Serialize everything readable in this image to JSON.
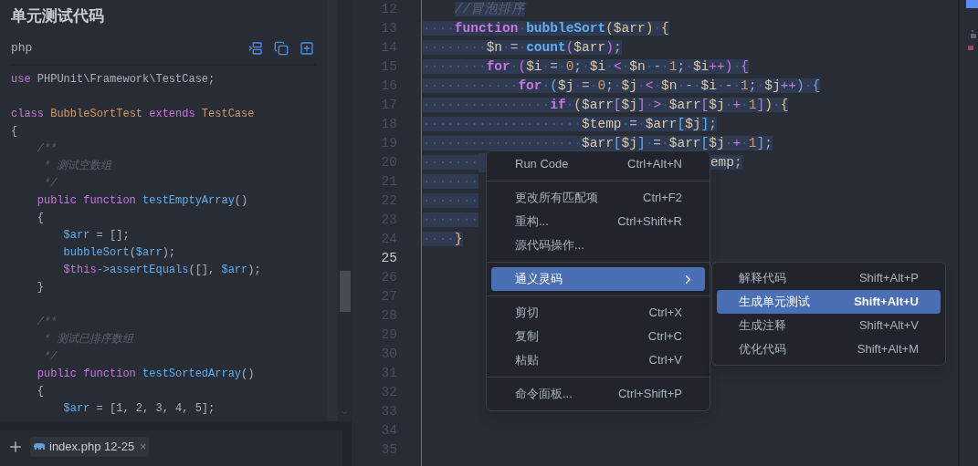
{
  "left_panel": {
    "title": "单元测试代码",
    "language": "php",
    "code_lines": [
      {
        "kind": "code",
        "tokens": [
          {
            "kind": "kw",
            "text": "use"
          },
          {
            "kind": "tx",
            "text": " PHPUnit\\Framework\\TestCase;"
          }
        ]
      },
      {
        "kind": "blank"
      },
      {
        "kind": "code",
        "tokens": [
          {
            "kind": "kw",
            "text": "class "
          },
          {
            "kind": "cls",
            "text": "BubbleSortTest "
          },
          {
            "kind": "kw",
            "text": "extends "
          },
          {
            "kind": "cls",
            "text": "TestCase"
          }
        ]
      },
      {
        "kind": "code",
        "tokens": [
          {
            "kind": "tx",
            "text": "{"
          }
        ]
      },
      {
        "kind": "code",
        "tokens": [
          {
            "kind": "cm",
            "text": "    /**"
          }
        ]
      },
      {
        "kind": "code",
        "tokens": [
          {
            "kind": "cm",
            "text": "     * 测试空数组"
          }
        ]
      },
      {
        "kind": "code",
        "tokens": [
          {
            "kind": "cm",
            "text": "     */"
          }
        ]
      },
      {
        "kind": "code",
        "tokens": [
          {
            "kind": "kw",
            "text": "    public function "
          },
          {
            "kind": "fn",
            "text": "testEmptyArray"
          },
          {
            "kind": "tx",
            "text": "()"
          }
        ]
      },
      {
        "kind": "code",
        "tokens": [
          {
            "kind": "tx",
            "text": "    {"
          }
        ]
      },
      {
        "kind": "code",
        "tokens": [
          {
            "kind": "var",
            "text": "        $arr"
          },
          {
            "kind": "tx",
            "text": " = [];"
          }
        ]
      },
      {
        "kind": "code",
        "tokens": [
          {
            "kind": "fn",
            "text": "        bubbleSort"
          },
          {
            "kind": "tx",
            "text": "("
          },
          {
            "kind": "var",
            "text": "$arr"
          },
          {
            "kind": "tx",
            "text": ");"
          }
        ]
      },
      {
        "kind": "code",
        "tokens": [
          {
            "kind": "th",
            "text": "        $this"
          },
          {
            "kind": "fn",
            "text": "->assertEquals"
          },
          {
            "kind": "tx",
            "text": "([], "
          },
          {
            "kind": "var",
            "text": "$arr"
          },
          {
            "kind": "tx",
            "text": ");"
          }
        ]
      },
      {
        "kind": "code",
        "tokens": [
          {
            "kind": "tx",
            "text": "    }"
          }
        ]
      },
      {
        "kind": "blank"
      },
      {
        "kind": "code",
        "tokens": [
          {
            "kind": "cm",
            "text": "    /**"
          }
        ]
      },
      {
        "kind": "code",
        "tokens": [
          {
            "kind": "cm",
            "text": "     * 测试已排序数组"
          }
        ]
      },
      {
        "kind": "code",
        "tokens": [
          {
            "kind": "cm",
            "text": "     */"
          }
        ]
      },
      {
        "kind": "code",
        "tokens": [
          {
            "kind": "kw",
            "text": "    public function "
          },
          {
            "kind": "fn",
            "text": "testSortedArray"
          },
          {
            "kind": "tx",
            "text": "()"
          }
        ]
      },
      {
        "kind": "code",
        "tokens": [
          {
            "kind": "tx",
            "text": "    {"
          }
        ]
      },
      {
        "kind": "code",
        "tokens": [
          {
            "kind": "var",
            "text": "        $arr"
          },
          {
            "kind": "tx",
            "text": " = [1, 2, 3, 4, 5];"
          }
        ]
      }
    ]
  },
  "bottom_bar": {
    "tab": {
      "label": "index.php 12-25",
      "close": "×"
    }
  },
  "editor": {
    "lines": [
      {
        "number": "12",
        "current": false,
        "selected": true,
        "kind": "indented",
        "tokens": [
          {
            "kind": "cm",
            "text": "//冒泡排序"
          }
        ]
      },
      {
        "number": "13",
        "current": false,
        "selected": true,
        "kind": "code",
        "tokens": [
          {
            "kind": "ws",
            "text": "····"
          },
          {
            "kind": "kw",
            "text": "function"
          },
          {
            "kind": "ws",
            "text": "·"
          },
          {
            "kind": "fn",
            "text": "bubbleSort"
          },
          {
            "kind": "b1",
            "text": "("
          },
          {
            "kind": "var",
            "text": "$arr"
          },
          {
            "kind": "b1",
            "text": ")"
          },
          {
            "kind": "ws",
            "text": "·"
          },
          {
            "kind": "b1",
            "text": "{"
          }
        ]
      },
      {
        "number": "14",
        "current": false,
        "selected": true,
        "kind": "code",
        "tokens": [
          {
            "kind": "ws",
            "text": "········"
          },
          {
            "kind": "var",
            "text": "$n"
          },
          {
            "kind": "ws",
            "text": "·"
          },
          {
            "kind": "p",
            "text": "="
          },
          {
            "kind": "ws",
            "text": "·"
          },
          {
            "kind": "fn",
            "text": "count"
          },
          {
            "kind": "b2",
            "text": "("
          },
          {
            "kind": "var",
            "text": "$arr"
          },
          {
            "kind": "b2",
            "text": ")"
          },
          {
            "kind": "p",
            "text": ";"
          }
        ]
      },
      {
        "number": "15",
        "current": false,
        "selected": true,
        "kind": "code",
        "tokens": [
          {
            "kind": "ws",
            "text": "········"
          },
          {
            "kind": "kw",
            "text": "for"
          },
          {
            "kind": "ws",
            "text": "·"
          },
          {
            "kind": "b2",
            "text": "("
          },
          {
            "kind": "var",
            "text": "$i"
          },
          {
            "kind": "ws",
            "text": "·"
          },
          {
            "kind": "p",
            "text": "="
          },
          {
            "kind": "ws",
            "text": "·"
          },
          {
            "kind": "num",
            "text": "0"
          },
          {
            "kind": "p",
            "text": ";"
          },
          {
            "kind": "ws",
            "text": "·"
          },
          {
            "kind": "var",
            "text": "$i"
          },
          {
            "kind": "ws",
            "text": "·"
          },
          {
            "kind": "op",
            "text": "<"
          },
          {
            "kind": "ws",
            "text": "·"
          },
          {
            "kind": "var",
            "text": "$n"
          },
          {
            "kind": "ws",
            "text": "·"
          },
          {
            "kind": "p",
            "text": "-"
          },
          {
            "kind": "ws",
            "text": "·"
          },
          {
            "kind": "num",
            "text": "1"
          },
          {
            "kind": "p",
            "text": ";"
          },
          {
            "kind": "ws",
            "text": "·"
          },
          {
            "kind": "var",
            "text": "$i"
          },
          {
            "kind": "op",
            "text": "++"
          },
          {
            "kind": "b2",
            "text": ")"
          },
          {
            "kind": "ws",
            "text": "·"
          },
          {
            "kind": "b2",
            "text": "{"
          }
        ]
      },
      {
        "number": "16",
        "current": false,
        "selected": true,
        "kind": "code",
        "tokens": [
          {
            "kind": "ws",
            "text": "············"
          },
          {
            "kind": "kw",
            "text": "for"
          },
          {
            "kind": "ws",
            "text": "·"
          },
          {
            "kind": "b3",
            "text": "("
          },
          {
            "kind": "var",
            "text": "$j"
          },
          {
            "kind": "ws",
            "text": "·"
          },
          {
            "kind": "p",
            "text": "="
          },
          {
            "kind": "ws",
            "text": "·"
          },
          {
            "kind": "num",
            "text": "0"
          },
          {
            "kind": "p",
            "text": ";"
          },
          {
            "kind": "ws",
            "text": "·"
          },
          {
            "kind": "var",
            "text": "$j"
          },
          {
            "kind": "ws",
            "text": "·"
          },
          {
            "kind": "op",
            "text": "<"
          },
          {
            "kind": "ws",
            "text": "·"
          },
          {
            "kind": "var",
            "text": "$n"
          },
          {
            "kind": "ws",
            "text": "·"
          },
          {
            "kind": "p",
            "text": "-"
          },
          {
            "kind": "ws",
            "text": "·"
          },
          {
            "kind": "var",
            "text": "$i"
          },
          {
            "kind": "ws",
            "text": "·"
          },
          {
            "kind": "p",
            "text": "-"
          },
          {
            "kind": "ws",
            "text": "·"
          },
          {
            "kind": "num",
            "text": "1"
          },
          {
            "kind": "p",
            "text": ";"
          },
          {
            "kind": "ws",
            "text": "·"
          },
          {
            "kind": "var",
            "text": "$j"
          },
          {
            "kind": "op",
            "text": "++"
          },
          {
            "kind": "b3",
            "text": ")"
          },
          {
            "kind": "ws",
            "text": "·"
          },
          {
            "kind": "b3",
            "text": "{"
          }
        ]
      },
      {
        "number": "17",
        "current": false,
        "selected": true,
        "kind": "code",
        "tokens": [
          {
            "kind": "ws",
            "text": "················"
          },
          {
            "kind": "kw",
            "text": "if"
          },
          {
            "kind": "ws",
            "text": "·"
          },
          {
            "kind": "b1",
            "text": "("
          },
          {
            "kind": "var",
            "text": "$arr"
          },
          {
            "kind": "b2",
            "text": "["
          },
          {
            "kind": "var",
            "text": "$j"
          },
          {
            "kind": "b2",
            "text": "]"
          },
          {
            "kind": "ws",
            "text": "·"
          },
          {
            "kind": "op",
            "text": ">"
          },
          {
            "kind": "ws",
            "text": "·"
          },
          {
            "kind": "var",
            "text": "$arr"
          },
          {
            "kind": "b2",
            "text": "["
          },
          {
            "kind": "var",
            "text": "$j"
          },
          {
            "kind": "ws",
            "text": "·"
          },
          {
            "kind": "op",
            "text": "+"
          },
          {
            "kind": "ws",
            "text": "·"
          },
          {
            "kind": "num",
            "text": "1"
          },
          {
            "kind": "b2",
            "text": "]"
          },
          {
            "kind": "b1",
            "text": ")"
          },
          {
            "kind": "ws",
            "text": "·"
          },
          {
            "kind": "b1",
            "text": "{"
          }
        ]
      },
      {
        "number": "18",
        "current": false,
        "selected": true,
        "kind": "code",
        "tokens": [
          {
            "kind": "ws",
            "text": "····················"
          },
          {
            "kind": "var",
            "text": "$temp"
          },
          {
            "kind": "ws",
            "text": "·"
          },
          {
            "kind": "p",
            "text": "="
          },
          {
            "kind": "ws",
            "text": "·"
          },
          {
            "kind": "var",
            "text": "$arr"
          },
          {
            "kind": "b3",
            "text": "["
          },
          {
            "kind": "var",
            "text": "$j"
          },
          {
            "kind": "b3",
            "text": "]"
          },
          {
            "kind": "p",
            "text": ";"
          }
        ]
      },
      {
        "number": "19",
        "current": false,
        "selected": true,
        "kind": "code",
        "tokens": [
          {
            "kind": "ws",
            "text": "····················"
          },
          {
            "kind": "var",
            "text": "$arr"
          },
          {
            "kind": "b3",
            "text": "["
          },
          {
            "kind": "var",
            "text": "$j"
          },
          {
            "kind": "b3",
            "text": "]"
          },
          {
            "kind": "ws",
            "text": "·"
          },
          {
            "kind": "p",
            "text": "="
          },
          {
            "kind": "ws",
            "text": "·"
          },
          {
            "kind": "var",
            "text": "$arr"
          },
          {
            "kind": "b3",
            "text": "["
          },
          {
            "kind": "var",
            "text": "$j"
          },
          {
            "kind": "ws",
            "text": "·"
          },
          {
            "kind": "op",
            "text": "+"
          },
          {
            "kind": "ws",
            "text": "·"
          },
          {
            "kind": "num",
            "text": "1"
          },
          {
            "kind": "b3",
            "text": "]"
          },
          {
            "kind": "p",
            "text": ";"
          }
        ]
      },
      {
        "number": "20",
        "current": false,
        "selected": true,
        "kind": "code",
        "tokens": [
          {
            "kind": "ws",
            "text": "·······"
          },
          {
            "kind": "gap"
          },
          {
            "kind": "var",
            "text": "emp"
          },
          {
            "kind": "p",
            "text": ";"
          }
        ]
      },
      {
        "number": "21",
        "current": false,
        "selected": true,
        "kind": "code",
        "tokens": [
          {
            "kind": "ws",
            "text": "·······"
          }
        ]
      },
      {
        "number": "22",
        "current": false,
        "selected": true,
        "kind": "code",
        "tokens": [
          {
            "kind": "ws",
            "text": "·······"
          }
        ]
      },
      {
        "number": "23",
        "current": false,
        "selected": true,
        "kind": "code",
        "tokens": [
          {
            "kind": "ws",
            "text": "·······"
          }
        ]
      },
      {
        "number": "24",
        "current": false,
        "selected": true,
        "kind": "code",
        "tokens": [
          {
            "kind": "ws",
            "text": "····"
          },
          {
            "kind": "b1",
            "text": "}"
          }
        ]
      },
      {
        "number": "25",
        "current": true,
        "kind": "empty"
      },
      {
        "number": "26",
        "current": false,
        "kind": "empty"
      },
      {
        "number": "27",
        "current": false,
        "kind": "empty"
      },
      {
        "number": "28",
        "current": false,
        "kind": "empty"
      },
      {
        "number": "29",
        "current": false,
        "kind": "empty"
      },
      {
        "number": "30",
        "current": false,
        "kind": "empty"
      },
      {
        "number": "31",
        "current": false,
        "kind": "empty"
      },
      {
        "number": "32",
        "current": false,
        "kind": "empty"
      },
      {
        "number": "33",
        "current": false,
        "kind": "empty"
      },
      {
        "number": "34",
        "current": false,
        "kind": "empty"
      },
      {
        "number": "35",
        "current": false,
        "kind": "empty"
      }
    ]
  },
  "context_menu": {
    "groups": [
      [
        {
          "label": "Run Code",
          "shortcut": "Ctrl+Alt+N",
          "selected": false,
          "submenu": false
        }
      ],
      [
        {
          "label": "更改所有匹配项",
          "shortcut": "Ctrl+F2",
          "selected": false,
          "submenu": false
        },
        {
          "label": "重构...",
          "shortcut": "Ctrl+Shift+R",
          "selected": false,
          "submenu": false
        },
        {
          "label": "源代码操作...",
          "selected": false,
          "submenu": false
        }
      ],
      [
        {
          "label": "通义灵码",
          "selected": true,
          "submenu": true
        }
      ],
      [
        {
          "label": "剪切",
          "shortcut": "Ctrl+X",
          "selected": false,
          "submenu": false
        },
        {
          "label": "复制",
          "shortcut": "Ctrl+C",
          "selected": false,
          "submenu": false
        },
        {
          "label": "粘贴",
          "shortcut": "Ctrl+V",
          "selected": false,
          "submenu": false
        }
      ],
      [
        {
          "label": "命令面板...",
          "shortcut": "Ctrl+Shift+P",
          "selected": false,
          "submenu": false
        }
      ]
    ]
  },
  "submenu": {
    "items": [
      {
        "label": "解释代码",
        "shortcut": "Shift+Alt+P",
        "selected": false
      },
      {
        "label": "生成单元测试",
        "shortcut": "Shift+Alt+U",
        "selected": true
      },
      {
        "label": "生成注释",
        "shortcut": "Shift+Alt+V",
        "selected": false
      },
      {
        "label": "优化代码",
        "shortcut": "Shift+Alt+M",
        "selected": false
      }
    ]
  }
}
